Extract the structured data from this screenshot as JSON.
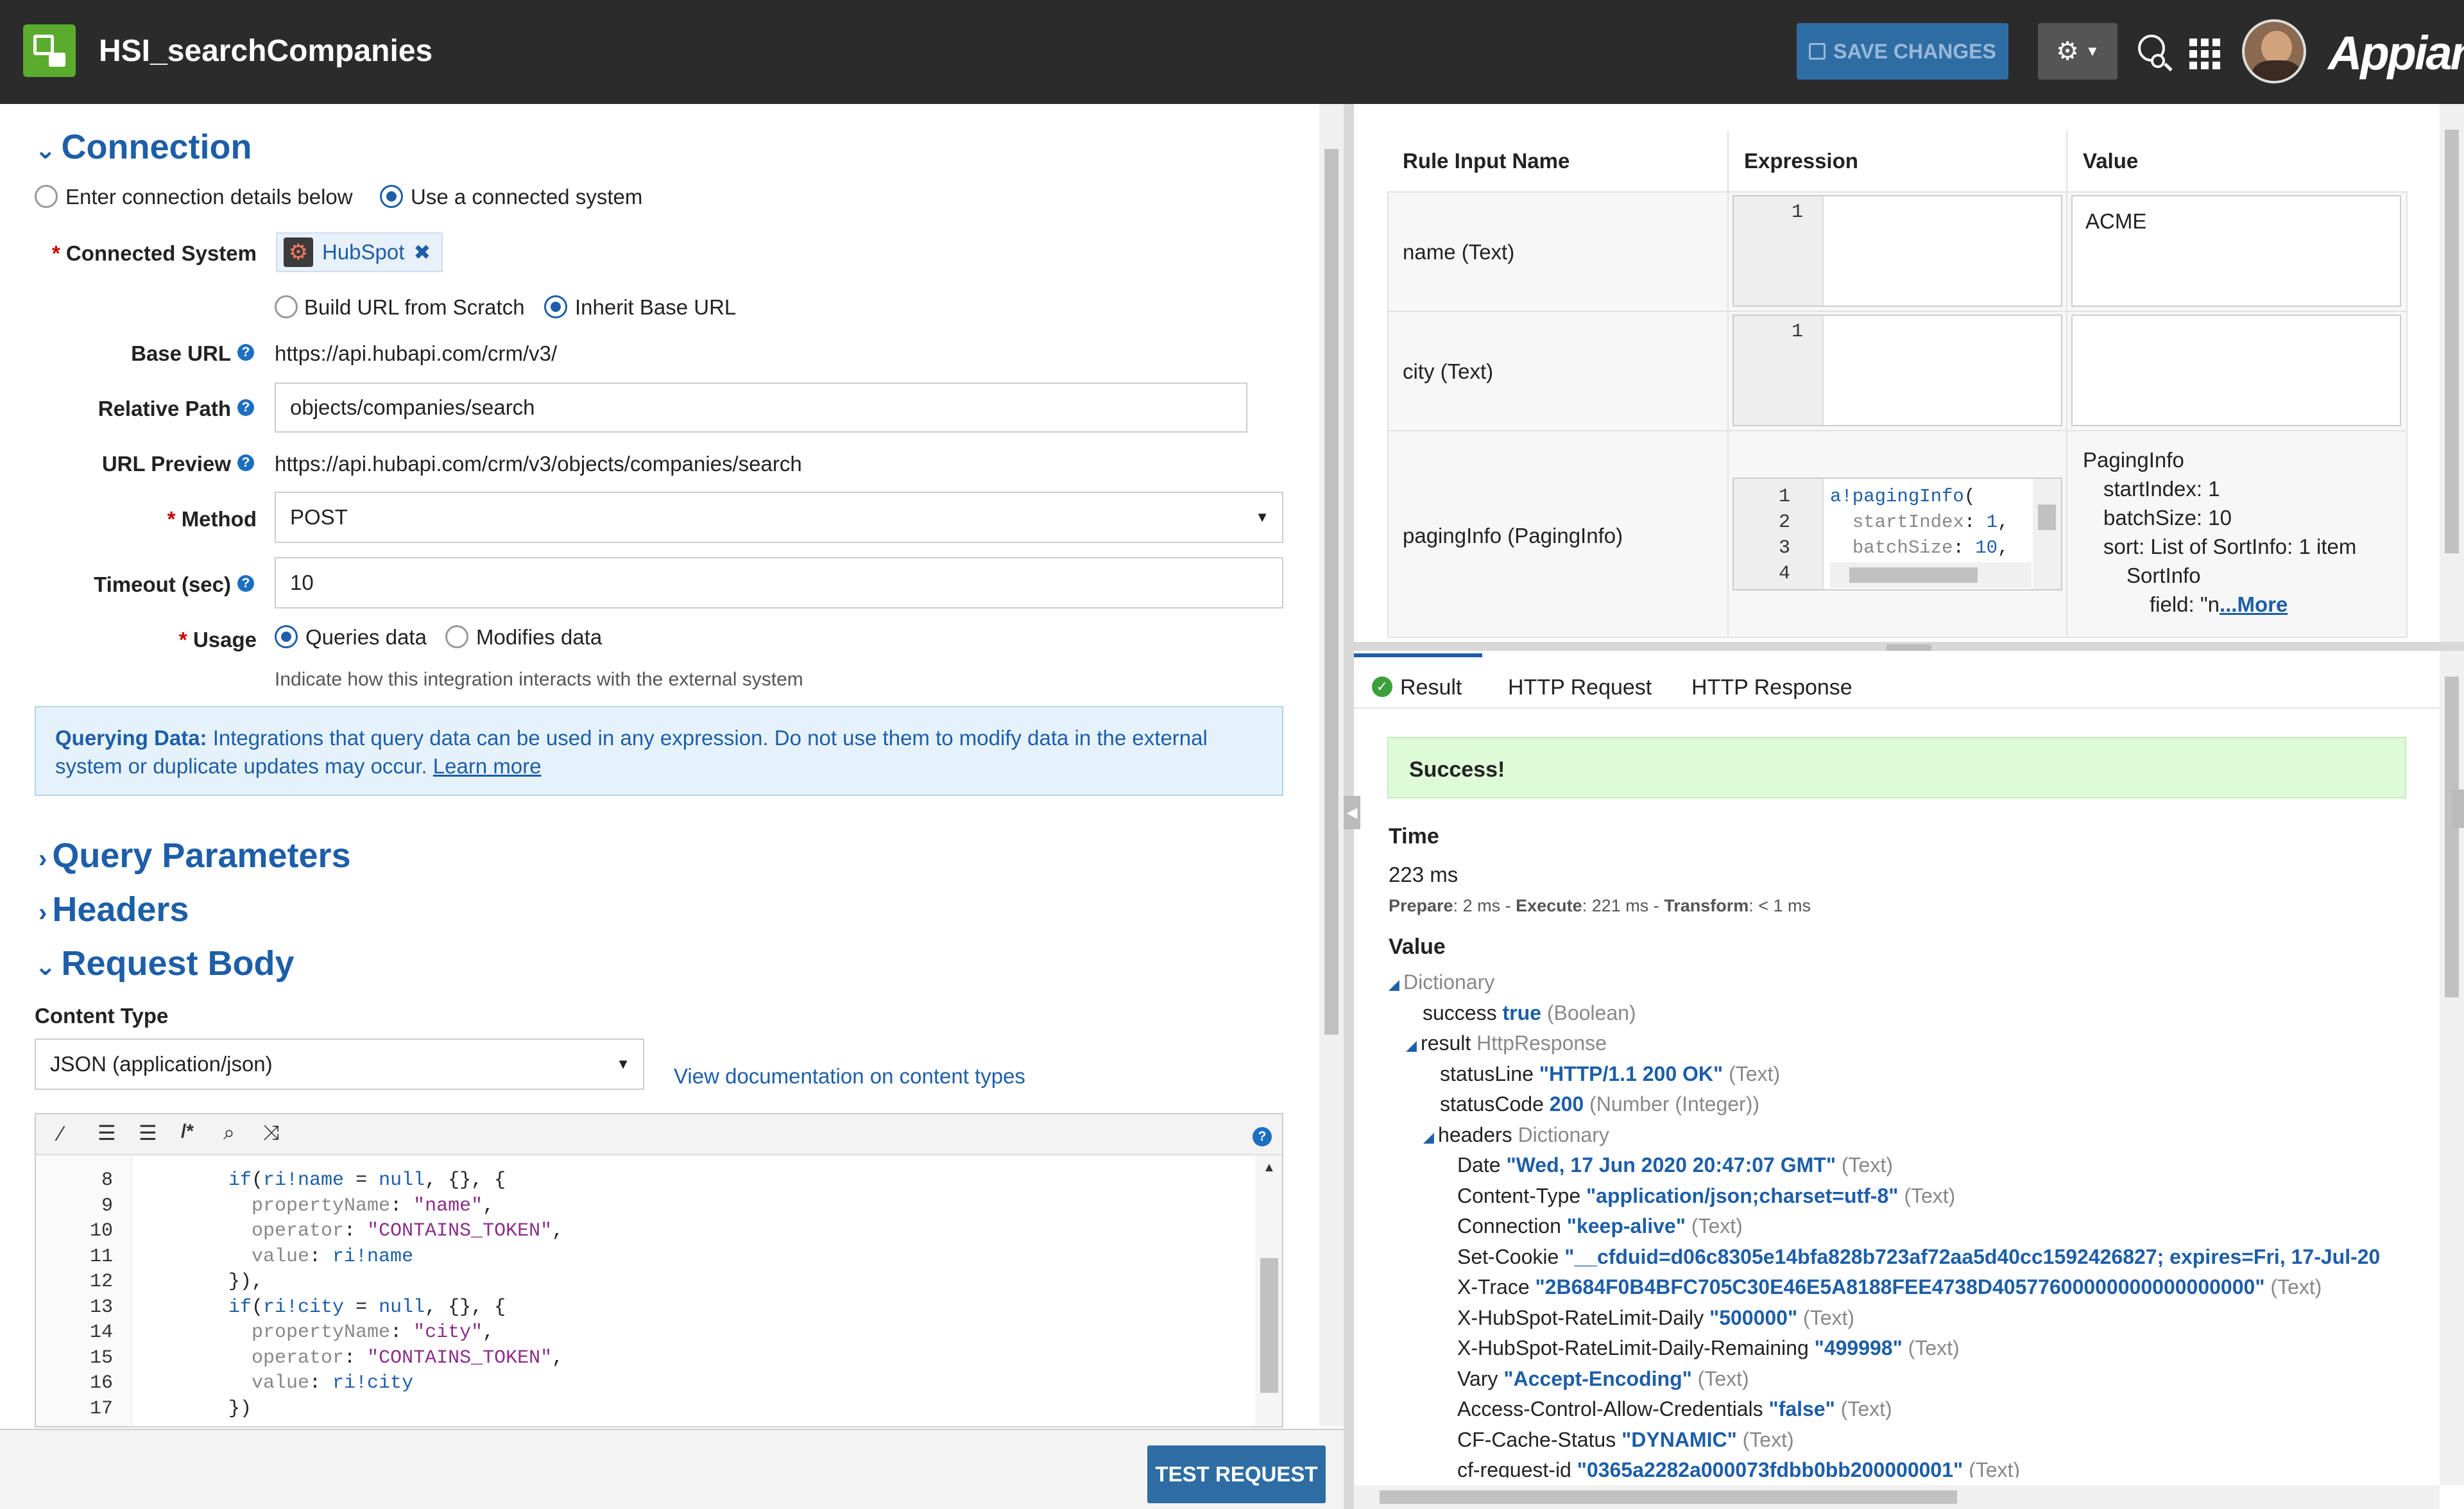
{
  "header": {
    "title": "HSI_searchCompanies",
    "save_label": "SAVE CHANGES",
    "brand": "Appian"
  },
  "connection": {
    "title": "Connection",
    "opt_enter": "Enter connection details below",
    "opt_use": "Use a connected system",
    "connected_system_label": "Connected System",
    "connected_system_value": "HubSpot",
    "opt_build": "Build URL from Scratch",
    "opt_inherit": "Inherit Base URL",
    "base_url_label": "Base URL",
    "base_url_value": "https://api.hubapi.com/crm/v3/",
    "relative_path_label": "Relative Path",
    "relative_path_value": "objects/companies/search",
    "url_preview_label": "URL Preview",
    "url_preview_value": "https://api.hubapi.com/crm/v3/objects/companies/search",
    "method_label": "Method",
    "method_value": "POST",
    "timeout_label": "Timeout (sec)",
    "timeout_value": "10",
    "usage_label": "Usage",
    "usage_queries": "Queries data",
    "usage_modifies": "Modifies data",
    "usage_hint": "Indicate how this integration interacts with the external system",
    "info_bold": "Querying Data:",
    "info_text": "Integrations that query data can be used in any expression. Do not use them to modify data in the external",
    "info_text2": "system or duplicate updates may occur.",
    "info_link": "Learn more"
  },
  "sections": {
    "query": "Query Parameters",
    "headers": "Headers",
    "body": "Request Body"
  },
  "request_body": {
    "content_type_label": "Content Type",
    "content_type_value": "JSON (application/json)",
    "doc_link": "View documentation on content types",
    "line_numbers": [
      "8",
      "9",
      "10",
      "11",
      "12",
      "13",
      "14",
      "15",
      "16",
      "17"
    ]
  },
  "test_button": "TEST REQUEST",
  "rule_table": {
    "headers": [
      "Rule Input Name",
      "Expression",
      "Value"
    ],
    "rows": [
      {
        "name": "name (Text)",
        "line": "1",
        "value": "ACME"
      },
      {
        "name": "city (Text)",
        "line": "1",
        "value": ""
      },
      {
        "name": "pagingInfo (PagingInfo)",
        "lines": [
          "1",
          "2",
          "3",
          "4"
        ]
      }
    ],
    "paging_value": [
      "PagingInfo",
      "startIndex: 1",
      "batchSize: 10",
      "sort: List of SortInfo: 1 item",
      "SortInfo",
      "field: \"n"
    ],
    "more": "...More"
  },
  "result": {
    "tabs": [
      "Result",
      "HTTP Request",
      "HTTP Response"
    ],
    "success": "Success!",
    "time_label": "Time",
    "time_value": "223 ms",
    "prepare_label": "Prepare",
    "prepare_value": ": 2 ms - ",
    "execute_label": "Execute",
    "execute_value": ": 221 ms - ",
    "transform_label": "Transform",
    "transform_value": ": < 1 ms",
    "value_label": "Value"
  },
  "tree": [
    {
      "indent": 0,
      "key": "Dictionary",
      "val": "",
      "type": "",
      "toggle": true,
      "keygray": true
    },
    {
      "indent": 1,
      "key": "success",
      "val": "true",
      "type": "(Boolean)"
    },
    {
      "indent": 1,
      "key": "result",
      "val": "",
      "type": "HttpResponse",
      "toggle": true
    },
    {
      "indent": 2,
      "key": "statusLine",
      "val": "\"HTTP/1.1 200 OK\"",
      "type": "(Text)"
    },
    {
      "indent": 2,
      "key": "statusCode",
      "val": "200",
      "type": "(Number (Integer))"
    },
    {
      "indent": 2,
      "key": "headers",
      "val": "",
      "type": "Dictionary",
      "toggle": true
    },
    {
      "indent": 3,
      "key": "Date",
      "val": "\"Wed, 17 Jun 2020 20:47:07 GMT\"",
      "type": "(Text)"
    },
    {
      "indent": 3,
      "key": "Content-Type",
      "val": "\"application/json;charset=utf-8\"",
      "type": "(Text)"
    },
    {
      "indent": 3,
      "key": "Connection",
      "val": "\"keep-alive\"",
      "type": "(Text)"
    },
    {
      "indent": 3,
      "key": "Set-Cookie",
      "val": "\"__cfduid=d06c8305e14bfa828b723af72aa5d40cc1592426827; expires=Fri, 17-Jul-20",
      "type": ""
    },
    {
      "indent": 3,
      "key": "X-Trace",
      "val": "\"2B684F0B4BFC705C30E46E5A8188FEE4738D40577600000000000000000\"",
      "type": "(Text)"
    },
    {
      "indent": 3,
      "key": "X-HubSpot-RateLimit-Daily",
      "val": "\"500000\"",
      "type": "(Text)"
    },
    {
      "indent": 3,
      "key": "X-HubSpot-RateLimit-Daily-Remaining",
      "val": "\"499998\"",
      "type": "(Text)"
    },
    {
      "indent": 3,
      "key": "Vary",
      "val": "\"Accept-Encoding\"",
      "type": "(Text)"
    },
    {
      "indent": 3,
      "key": "Access-Control-Allow-Credentials",
      "val": "\"false\"",
      "type": "(Text)"
    },
    {
      "indent": 3,
      "key": "CF-Cache-Status",
      "val": "\"DYNAMIC\"",
      "type": "(Text)"
    },
    {
      "indent": 3,
      "key": "cf-request-id",
      "val": "\"0365a2282a000073fdbb0bb200000001\"",
      "type": "(Text)"
    }
  ]
}
